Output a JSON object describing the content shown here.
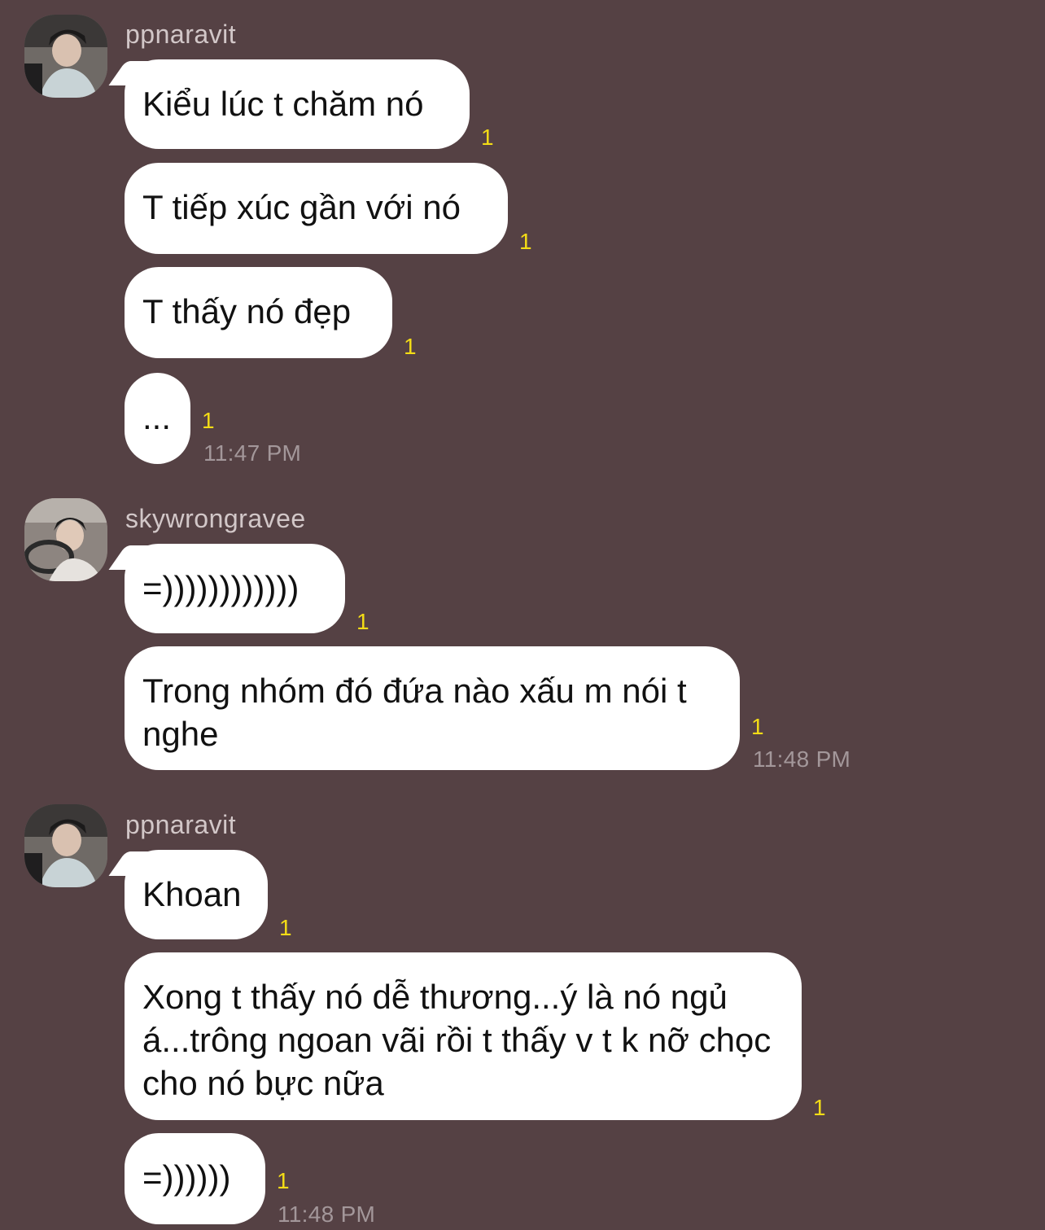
{
  "groups": [
    {
      "sender": "ppnaravit",
      "avatar_icon": "profile-photo-icon",
      "messages": [
        {
          "text": "Kiểu lúc t chăm nó",
          "read": "1"
        },
        {
          "text": "T tiếp xúc gần với nó",
          "read": "1"
        },
        {
          "text": "T thấy nó đẹp",
          "read": "1"
        },
        {
          "text": "...",
          "read": "1"
        }
      ],
      "time": "11:47 PM"
    },
    {
      "sender": "skywrongravee",
      "avatar_icon": "profile-photo-icon",
      "messages": [
        {
          "text": "=))))))))))))",
          "read": "1"
        },
        {
          "text": "Trong nhóm đó đứa nào xấu m nói t nghe",
          "read": "1"
        }
      ],
      "time": "11:48 PM"
    },
    {
      "sender": "ppnaravit",
      "avatar_icon": "profile-photo-icon",
      "messages": [
        {
          "text": "Khoan",
          "read": "1"
        },
        {
          "text": "Xong t thấy nó dễ thương...ý là nó ngủ á...trông ngoan vãi rồi t thấy v t k nỡ chọc cho nó bực nữa",
          "read": "1"
        },
        {
          "text": "=))))))",
          "read": "1"
        }
      ],
      "time": "11:48 PM"
    }
  ],
  "colors": {
    "background": "#554144",
    "bubble": "#ffffff",
    "read_indicator": "#f3dc16",
    "timestamp": "#a3979a",
    "sender": "#d2c7c8"
  }
}
